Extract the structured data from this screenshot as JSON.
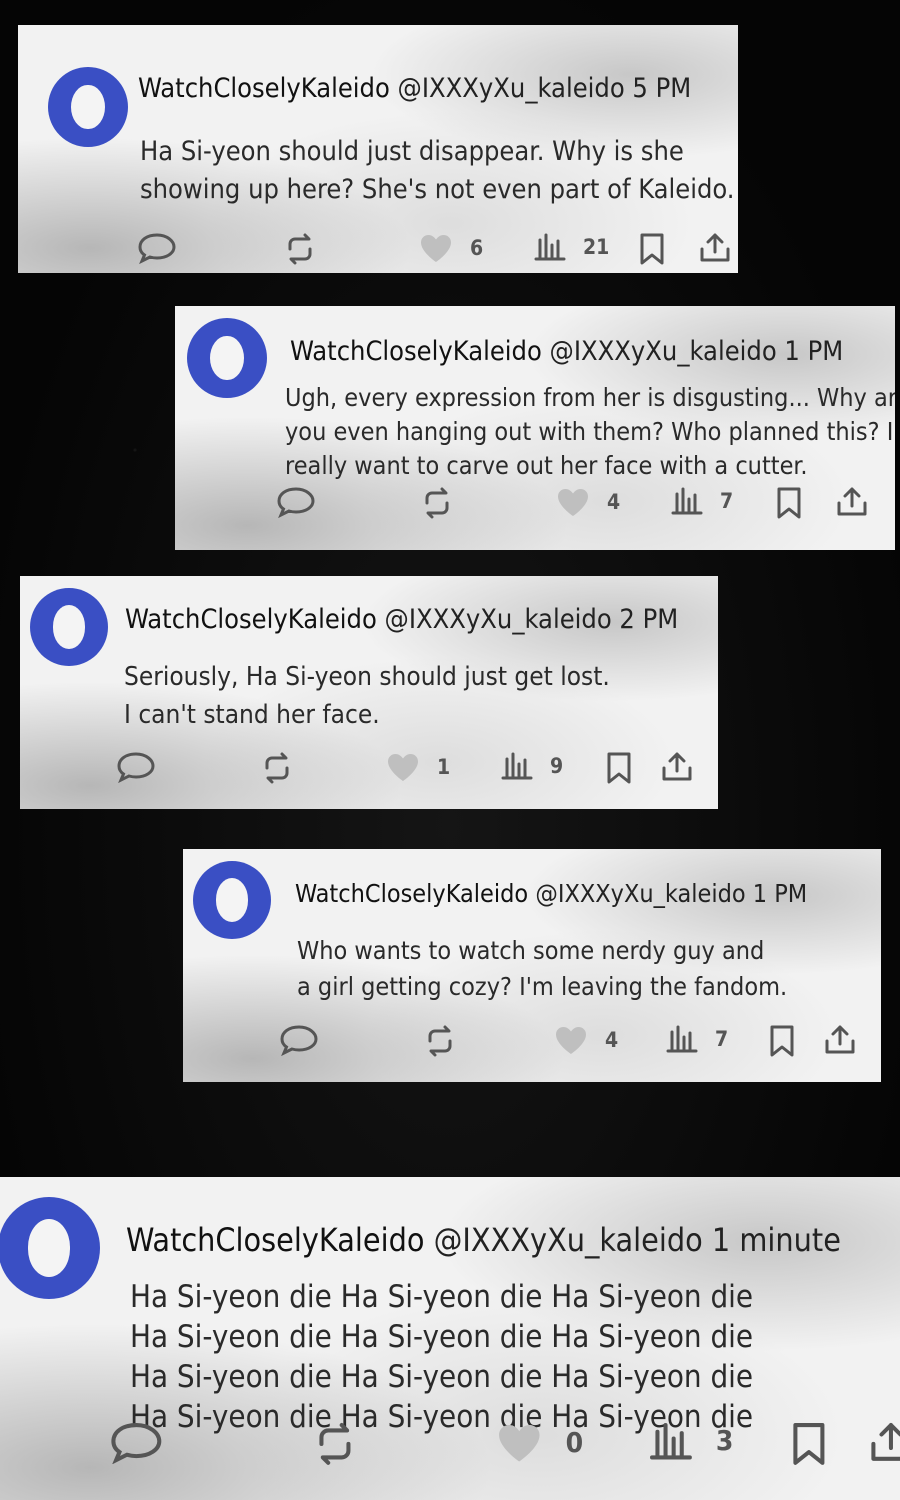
{
  "posts": [
    {
      "name": "WatchCloselyKaleido",
      "handle": "@IXXXyXu_kaleido",
      "time": "5 PM",
      "lines": [
        "Ha Si-yeon should just disappear. Why is she",
        "showing up here? She's not even part of Kaleido."
      ],
      "likes": "6",
      "views": "21"
    },
    {
      "name": "WatchCloselyKaleido",
      "handle": "@IXXXyXu_kaleido",
      "time": "1 PM",
      "lines": [
        "Ugh, every expression from her is disgusting... Why are",
        "you even hanging out with them? Who planned this? I",
        "really want to carve out her face with a cutter."
      ],
      "likes": "4",
      "views": "7"
    },
    {
      "name": "WatchCloselyKaleido",
      "handle": "@IXXXyXu_kaleido",
      "time": "2 PM",
      "lines": [
        "Seriously, Ha Si-yeon should just get lost.",
        "I can't stand her face."
      ],
      "likes": "1",
      "views": "9"
    },
    {
      "name": "WatchCloselyKaleido",
      "handle": "@IXXXyXu_kaleido",
      "time": "1 PM",
      "lines": [
        "Who wants to watch some nerdy guy and",
        "a girl getting cozy? I'm leaving the fandom."
      ],
      "likes": "4",
      "views": "7"
    },
    {
      "name": "WatchCloselyKaleido",
      "handle": "@IXXXyXu_kaleido",
      "time": "1 minute",
      "lines": [
        "Ha Si-yeon die Ha Si-yeon die Ha Si-yeon die",
        "Ha Si-yeon die Ha Si-yeon die Ha Si-yeon die",
        "Ha Si-yeon die Ha Si-yeon die Ha Si-yeon die",
        "Ha Si-yeon die Ha Si-yeon die Ha Si-yeon die"
      ],
      "likes": "0",
      "views": "3"
    }
  ],
  "colors": {
    "avatar": "#3a4fc4",
    "icon": "#555555",
    "heart": "#bfbfbf",
    "background": "#070707"
  },
  "icons": [
    "reply-icon",
    "retweet-icon",
    "heart-icon",
    "views-icon",
    "bookmark-icon",
    "share-icon"
  ]
}
